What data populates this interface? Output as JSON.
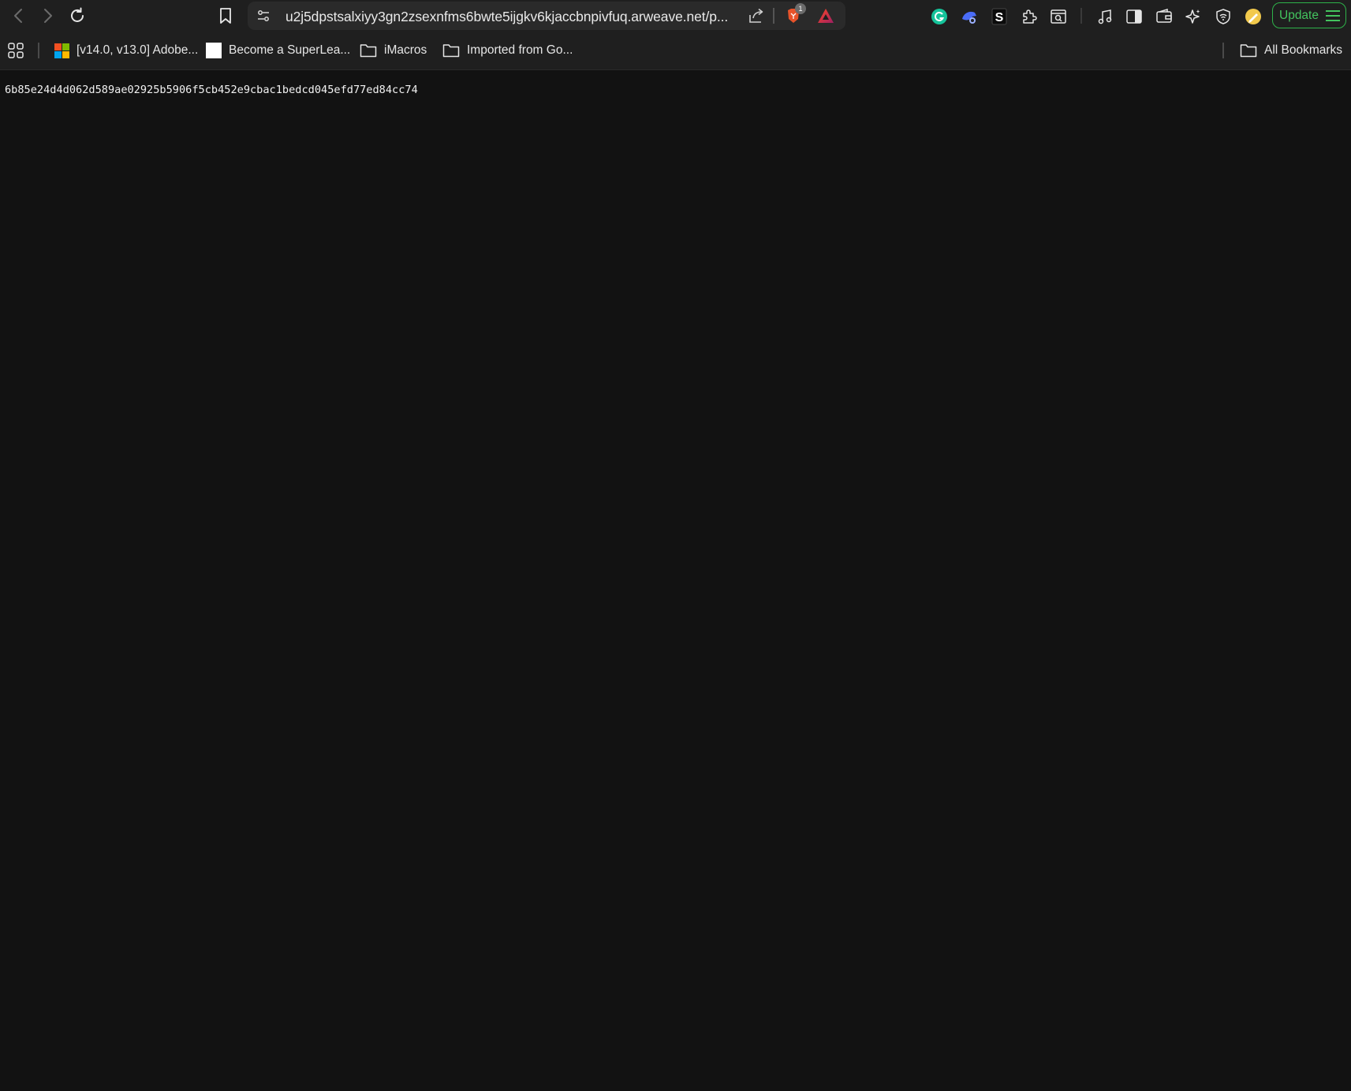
{
  "toolbar": {
    "url": "u2j5dpstsalxiyy3gn2zsexnfms6bwte5ijgkv6kjaccbnpivfuq.arweave.net/p...",
    "brave_shield_badge": "1",
    "update_label": "Update"
  },
  "bookmarks": {
    "items": [
      {
        "label": "[v14.0, v13.0] Adobe...",
        "icon": "microsoft-logo-icon"
      },
      {
        "label": "Become a SuperLea...",
        "icon": "white-square-icon"
      },
      {
        "label": "iMacros",
        "icon": "folder-icon"
      },
      {
        "label": "Imported from Go...",
        "icon": "folder-icon"
      }
    ],
    "all_bookmarks_label": "All Bookmarks"
  },
  "page": {
    "content_text": "6b85e24d4d062d589ae02925b5906f5cb452e9cbac1bedcd045efd77ed84cc74"
  },
  "colors": {
    "chrome_bg": "#1f1f1f",
    "page_bg": "#121212",
    "url_bar_bg": "#2a2a2a",
    "update_accent": "#2eb24a"
  }
}
